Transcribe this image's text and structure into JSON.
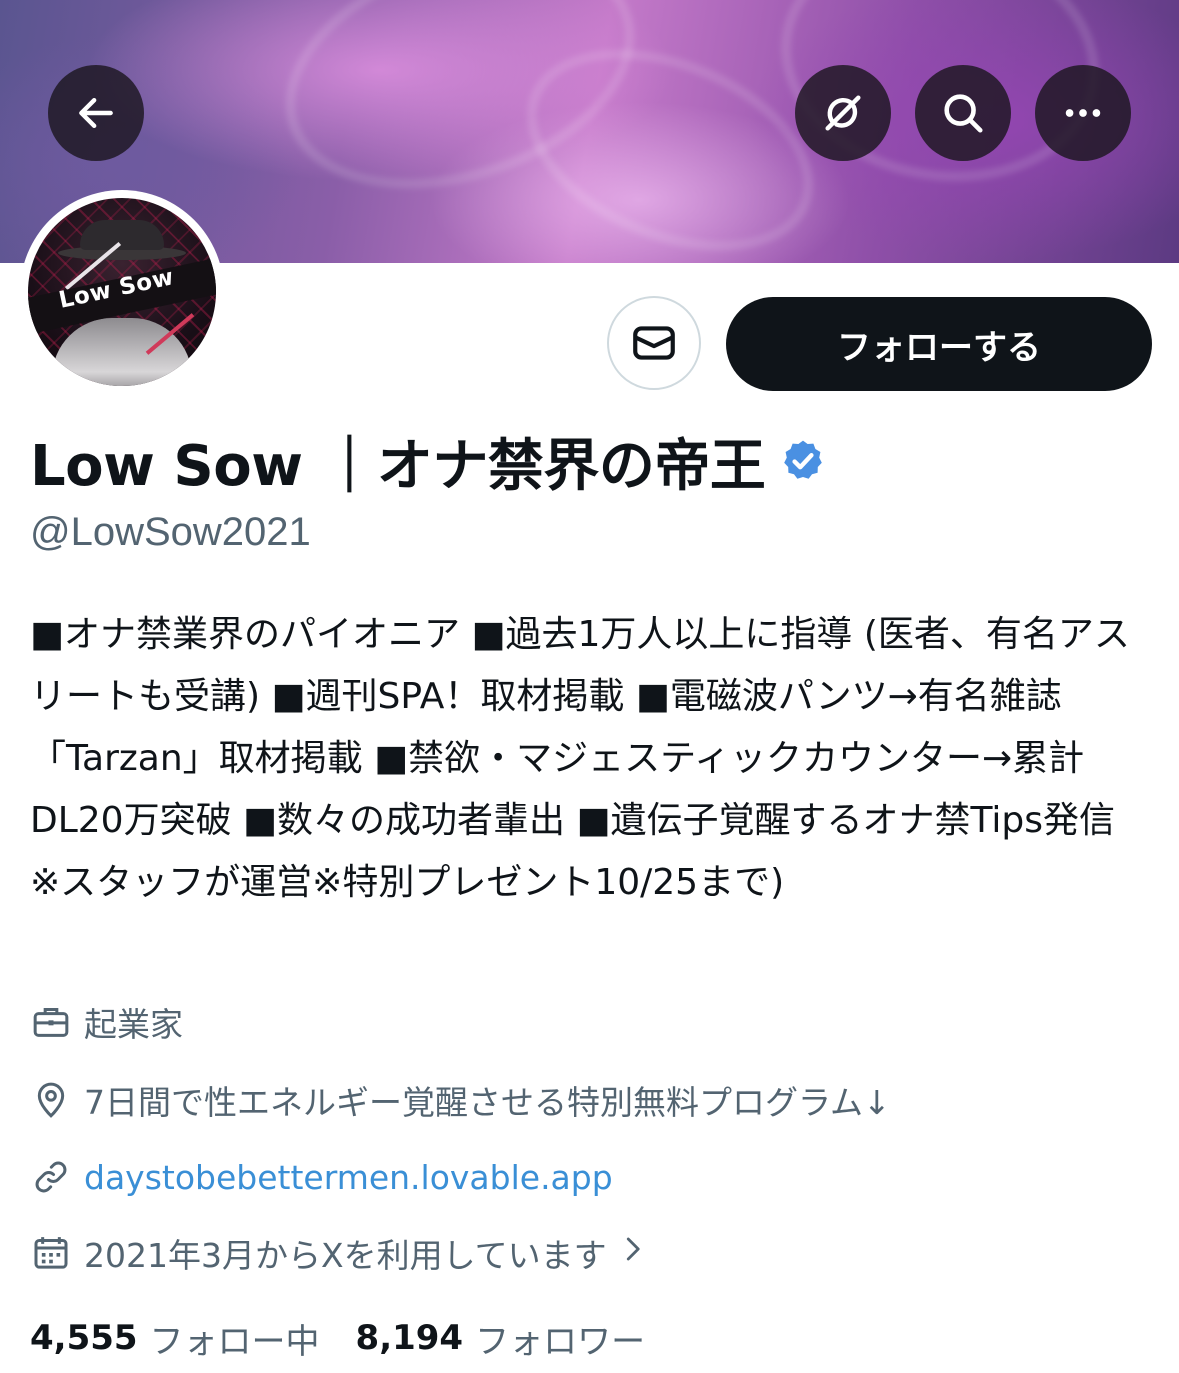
{
  "header": {
    "back_icon": "arrow-left-icon",
    "grok_icon": "grok-icon",
    "search_icon": "search-icon",
    "more_icon": "more-horizontal-icon",
    "banner_colors": [
      "#5a5590",
      "#c47ac9",
      "#5c3a82"
    ]
  },
  "avatar": {
    "logo_text": "Low Sow"
  },
  "actions": {
    "message_icon": "mail-icon",
    "follow_label": "フォローする"
  },
  "profile": {
    "display_name": "Low Sow ｜オナ禁界の帝王",
    "verified_icon": "verified-badge-icon",
    "verified_color": "#4a90e2",
    "handle": "@LowSow2021",
    "bio": "■オナ禁業界のパイオニア ■過去1万人以上に指導 (医者、有名アスリートも受講) ■週刊SPA！取材掲載 ■電磁波パンツ→有名雑誌「Tarzan」取材掲載 ■禁欲・マジェスティックカウンター→累計DL20万突破 ■数々の成功者輩出 ■遺伝子覚醒するオナ禁Tips発信 ※スタッフが運営※特別プレゼント10/25まで)",
    "profession": "起業家",
    "location": "7日間で性エネルギー覚醒させる特別無料プログラム↓",
    "website": "daystobebettermen.lovable.app",
    "joined": "2021年3月からXを利用しています",
    "link_color": "#3a8fd6"
  },
  "stats": {
    "following_count": "4,555",
    "following_label": "フォロー中",
    "followers_count": "8,194",
    "followers_label": "フォロワー"
  }
}
